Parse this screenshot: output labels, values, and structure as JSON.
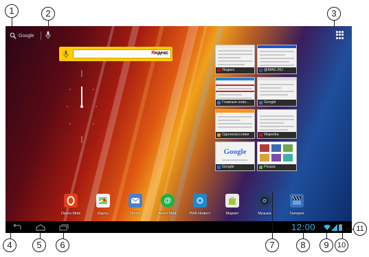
{
  "top_bar": {
    "search_label": "Google",
    "icons": [
      "search-icon",
      "microphone-icon",
      "all-apps-icon"
    ]
  },
  "yandex_widget": {
    "logo": "Яндекс",
    "logo_first_letter": "Я",
    "logo_rest": "ндекс"
  },
  "recent_apps": [
    {
      "label": "Яндекс",
      "icon_color": "#e00000"
    },
    {
      "label": "@MAIL.RU",
      "icon_color": "#1a56c8"
    },
    {
      "label": "Главные ново...",
      "icon_color": "#2a7fd4"
    },
    {
      "label": "Google",
      "icon_color": "#3869d4"
    },
    {
      "label": "Одноклассники",
      "icon_color": "#f7931e"
    },
    {
      "label": "Wapedia",
      "icon_color": "#c8102e"
    },
    {
      "label": "Google",
      "icon_color": "#3869d4",
      "page_logo": "Google"
    },
    {
      "label": "Picasa",
      "icon_color": "#6aa84f"
    }
  ],
  "dock": [
    {
      "label": "Opera Mobi",
      "icon": "opera-icon",
      "color": "#e53a1d"
    },
    {
      "label": "Карты",
      "icon": "maps-icon",
      "color": "#f4f4f4"
    },
    {
      "label": "Почта",
      "icon": "mail-icon",
      "color": "#4a7fd0"
    },
    {
      "label": "Агент Mail.",
      "icon": "mail-agent-icon",
      "color": "#1bb24a"
    },
    {
      "label": "РИА Новост",
      "icon": "ria-news-icon",
      "color": "#1e88c8"
    },
    {
      "label": "Маркет",
      "icon": "market-icon",
      "color": "#e9e9e9"
    },
    {
      "label": "Музыка",
      "icon": "music-icon",
      "color": "#2a3a5a"
    },
    {
      "label": "Галерея",
      "icon": "gallery-icon",
      "color": "#3a70b8"
    }
  ],
  "system_bar": {
    "time": "12:00",
    "icons": [
      "back-icon",
      "home-icon",
      "recent-apps-icon",
      "wifi-icon",
      "signal-icon",
      "battery-icon"
    ]
  },
  "callouts": [
    "1",
    "2",
    "3",
    "4",
    "5",
    "6",
    "7",
    "8",
    "9",
    "10",
    "11"
  ],
  "colors": {
    "status_clock": "#33b5e5",
    "yandex_yellow": "#ffcc00",
    "system_bar": "#000000"
  }
}
